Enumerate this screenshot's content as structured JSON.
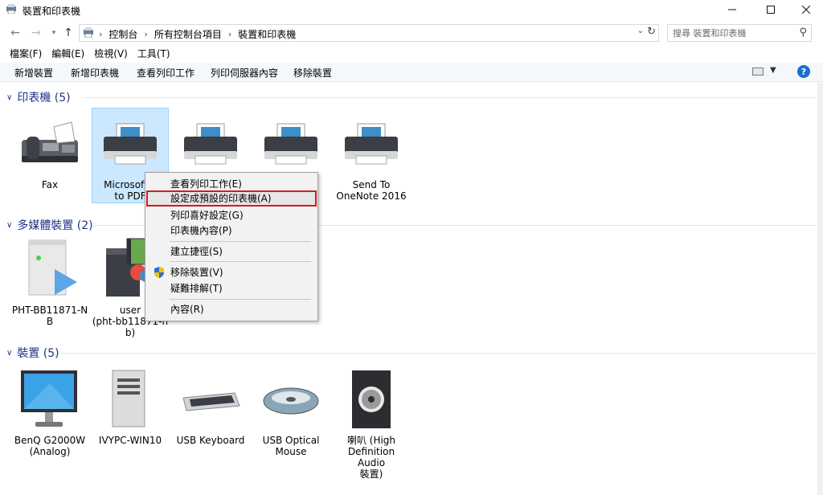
{
  "window": {
    "title": "裝置和印表機"
  },
  "address": {
    "crumbs": [
      "控制台",
      "所有控制台項目",
      "裝置和印表機"
    ],
    "search_placeholder": "搜尋 裝置和印表機"
  },
  "menu": [
    "檔案(F)",
    "編輯(E)",
    "檢視(V)",
    "工具(T)"
  ],
  "toolbar": [
    "新增裝置",
    "新增印表機",
    "查看列印工作",
    "列印伺服器內容",
    "移除裝置"
  ],
  "groups": {
    "printers": {
      "title": "印表機 (5)",
      "items": [
        {
          "line1": "Fax",
          "line2": ""
        },
        {
          "line1": "Microsoft P",
          "line2": "to PDF"
        },
        {
          "line1": "",
          "line2": ""
        },
        {
          "line1": "",
          "line2": ""
        },
        {
          "line1": "Send To",
          "line2": "OneNote 2016"
        }
      ]
    },
    "multimedia": {
      "title": "多媒體裝置 (2)",
      "items": [
        {
          "line1": "PHT-BB11871-N",
          "line2": "B",
          "line3": ""
        },
        {
          "line1": "user",
          "line2": "(pht-bb11871-n",
          "line3": "b)"
        }
      ]
    },
    "devices": {
      "title": "裝置 (5)",
      "items": [
        {
          "line1": "BenQ G2000W",
          "line2": "(Analog)",
          "line3": ""
        },
        {
          "line1": "IVYPC-WIN10",
          "line2": "",
          "line3": ""
        },
        {
          "line1": "USB Keyboard",
          "line2": "",
          "line3": ""
        },
        {
          "line1": "USB Optical",
          "line2": "Mouse",
          "line3": ""
        },
        {
          "line1": "喇叭 (High",
          "line2": "Definition Audio",
          "line3": "裝置)"
        }
      ]
    }
  },
  "context_menu": {
    "items": [
      "查看列印工作(E)",
      "設定成預設的印表機(A)",
      "列印喜好設定(G)",
      "印表機內容(P)",
      "建立捷徑(S)",
      "移除裝置(V)",
      "疑難排解(T)",
      "內容(R)"
    ]
  },
  "colors": {
    "group_title": "#1e3287",
    "selection": "#cce8ff",
    "highlight_border": "#d61a20"
  }
}
